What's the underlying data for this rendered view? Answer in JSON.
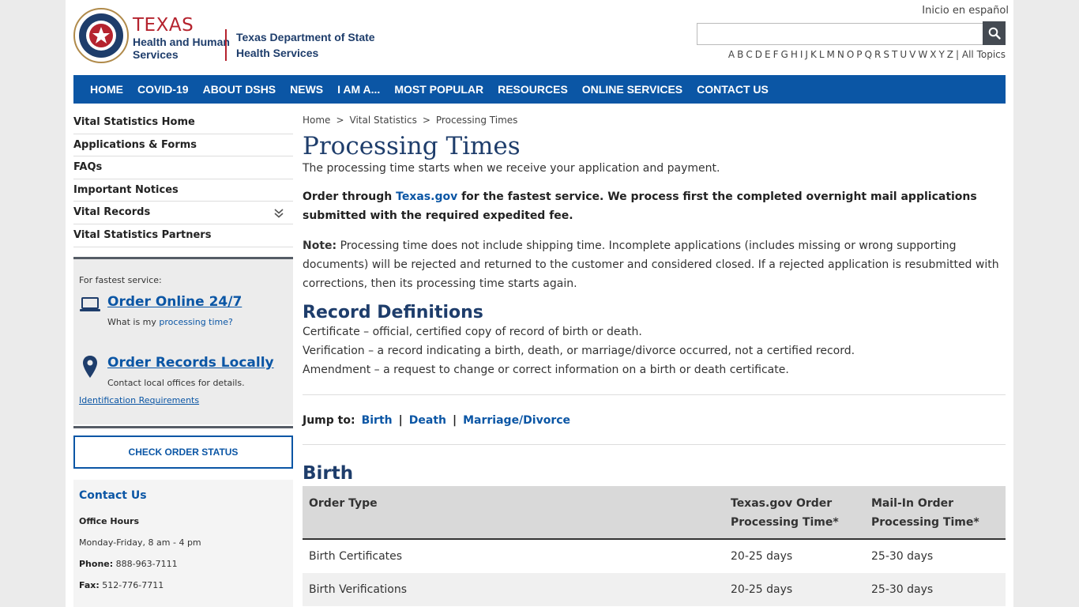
{
  "header": {
    "hhs_title": "TEXAS",
    "hhs_subtitle_line1": "Health and Human",
    "hhs_subtitle_line2": "Services",
    "dshs_line1": "Texas Department of State",
    "dshs_line2": "Health Services",
    "language_link": "Inicio en español",
    "search_placeholder": "",
    "az_letters": [
      "A",
      "B",
      "C",
      "D",
      "E",
      "F",
      "G",
      "H",
      "I",
      "J",
      "K",
      "L",
      "M",
      "N",
      "O",
      "P",
      "Q",
      "R",
      "S",
      "T",
      "U",
      "V",
      "W",
      "X",
      "Y",
      "Z"
    ],
    "all_topics": "| All Topics"
  },
  "nav": {
    "items": [
      "Home",
      "COVID-19",
      "About DSHS",
      "News",
      "I am a...",
      "Most Popular",
      "Resources",
      "Online Services",
      "Contact Us"
    ]
  },
  "sidebar": {
    "items": [
      "Vital Statistics Home",
      "Applications & Forms",
      "FAQs",
      "Important Notices",
      "Vital Records",
      "Vital Statistics Partners"
    ],
    "fastest_label": "For fastest service:",
    "order_online": "Order Online 24/7",
    "order_online_note_prefix": "What is my ",
    "order_online_note_link": "processing time?",
    "order_local": "Order Records Locally",
    "order_local_note": "Contact local offices for details.",
    "id_requirements": "Identification Requirements",
    "check_status": "CHECK ORDER STATUS",
    "contact_title": "Contact Us",
    "office_hours_label": "Office Hours",
    "office_hours": "Monday-Friday, 8 am - 4 pm",
    "phone_label": "Phone:",
    "phone": "888-963-7111",
    "fax_label": "Fax:",
    "fax": "512-776-7711"
  },
  "main": {
    "breadcrumb": [
      "Home",
      ">",
      "Vital Statistics",
      ">",
      "Processing Times"
    ],
    "title": "Processing Times",
    "intro": "The processing time starts when we receive your application and payment.",
    "fast_prefix": "Order through ",
    "fast_link": "Texas.gov",
    "fast_suffix": " for the fastest service. We process first the completed overnight mail applications submitted with the required expedited fee.",
    "note_label": "Note:",
    "note_text": " Processing time does not include shipping time. Incomplete applications (includes missing or wrong supporting documents) will be rejected and returned to the customer and considered closed. If a rejected application is resubmitted with corrections, then its processing time starts again.",
    "record_defs_title": "Record Definitions",
    "definitions": [
      "Certificate – official, certified copy of record of birth or death.",
      "Verification – a record indicating a birth, death, or marriage/divorce occurred, not a certified record.",
      "Amendment – a request to change or correct information on a birth or death certificate."
    ],
    "jump_label": "Jump to:",
    "jump_links": [
      "Birth",
      "Death",
      "Marriage/Divorce"
    ],
    "jump_sep": "|",
    "birth_title": "Birth",
    "table_headers": [
      "Order Type",
      "Texas.gov Order Processing Time*",
      "Mail-In Order Processing Time*"
    ],
    "table_rows": [
      [
        "Birth Certificates",
        "20-25 days",
        "25-30 days"
      ],
      [
        "Birth Verifications",
        "20-25 days",
        "25-30 days"
      ]
    ]
  }
}
